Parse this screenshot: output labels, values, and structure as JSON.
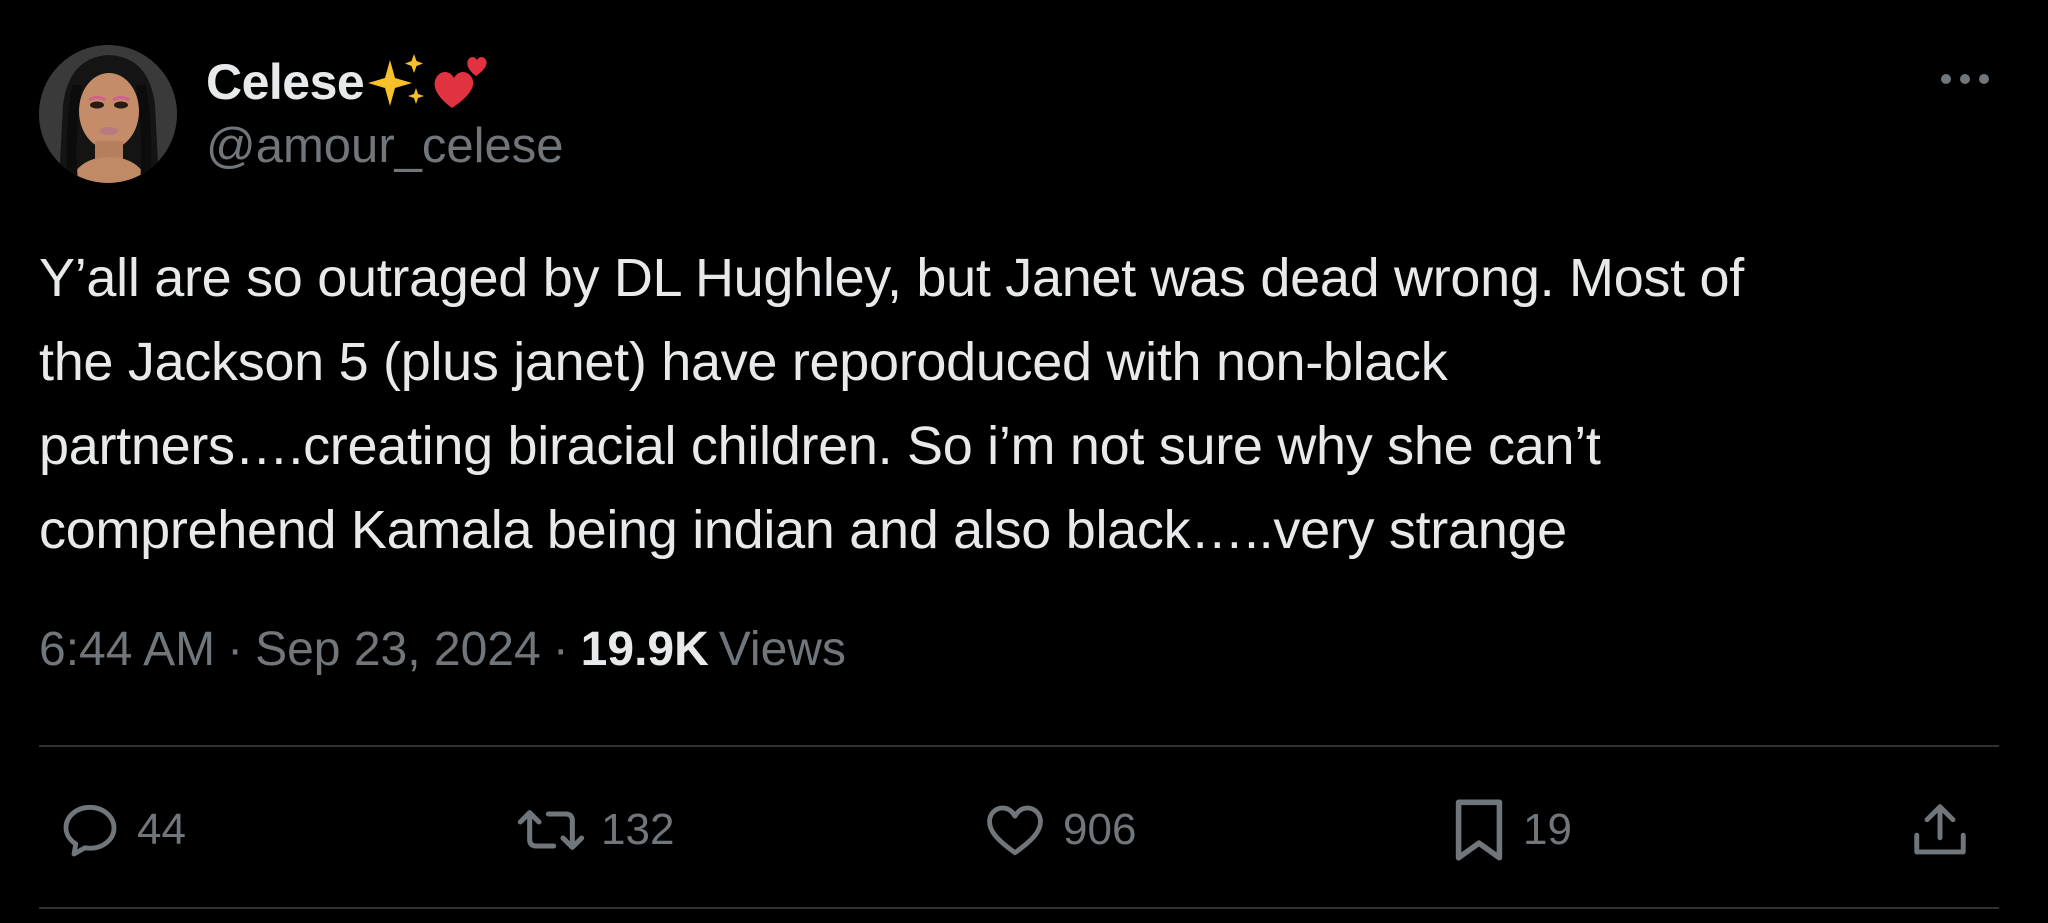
{
  "author": {
    "display_name": "Celese",
    "name_emojis": [
      "sparkles-emoji",
      "two-hearts-emoji"
    ],
    "handle": "@amour_celese",
    "avatar": "profile-photo"
  },
  "tweet": {
    "text": "Y’all are so outraged by DL Hughley, but Janet was dead wrong. Most of\nthe Jackson 5 (plus janet) have reporoduced with non-black\npartners….creating biracial children. So i’m not sure why she can’t\ncomprehend Kamala being indian and also black…..very strange"
  },
  "meta": {
    "time": "6:44 AM",
    "separator": "·",
    "date": "Sep 23, 2024",
    "views_count": "19.9K",
    "views_label": "Views"
  },
  "actions": {
    "reply": {
      "icon": "reply-icon",
      "count": "44"
    },
    "repost": {
      "icon": "repost-icon",
      "count": "132"
    },
    "like": {
      "icon": "heart-icon",
      "count": "906"
    },
    "bookmark": {
      "icon": "bookmark-icon",
      "count": "19"
    },
    "share": {
      "icon": "share-icon"
    }
  },
  "more_menu": {
    "icon": "more-horizontal-icon"
  },
  "colors": {
    "background": "#000000",
    "primary_text": "#e7e9ea",
    "secondary_text": "#71767b",
    "divider": "#2f3336"
  }
}
